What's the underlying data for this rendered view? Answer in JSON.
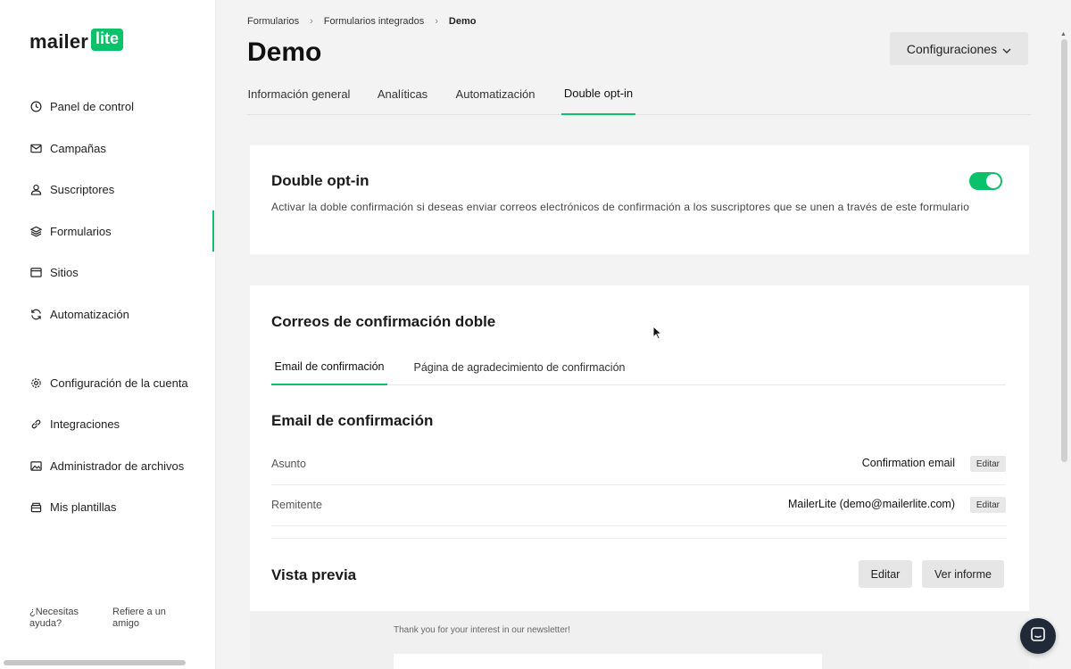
{
  "brand": {
    "logo_text": "mailer",
    "logo_badge": "lite",
    "accent": "#09c269"
  },
  "sidebar": {
    "items": [
      {
        "label": "Panel de control",
        "icon": "dashboard-icon"
      },
      {
        "label": "Campañas",
        "icon": "mail-icon"
      },
      {
        "label": "Suscriptores",
        "icon": "user-icon"
      },
      {
        "label": "Formularios",
        "icon": "layers-icon",
        "active": true
      },
      {
        "label": "Sitios",
        "icon": "browser-icon"
      },
      {
        "label": "Automatización",
        "icon": "refresh-icon"
      },
      {
        "label": "Configuración de la cuenta",
        "icon": "gear-icon"
      },
      {
        "label": "Integraciones",
        "icon": "link-icon"
      },
      {
        "label": "Administrador de archivos",
        "icon": "image-icon"
      },
      {
        "label": "Mis plantillas",
        "icon": "template-icon"
      }
    ],
    "help": {
      "line1": "¿Necesitas",
      "line2": "ayuda?"
    },
    "refer": {
      "line1": "Refiere a un",
      "line2": "amigo"
    }
  },
  "breadcrumb": [
    "Formularios",
    "Formularios integrados",
    "Demo"
  ],
  "page_title": "Demo",
  "config_button": "Configuraciones",
  "tabs": [
    {
      "label": "Información general"
    },
    {
      "label": "Analíticas"
    },
    {
      "label": "Automatización"
    },
    {
      "label": "Double opt-in",
      "active": true
    }
  ],
  "double_optin": {
    "title": "Double opt-in",
    "description": "Activar la doble confirmación si deseas enviar correos electrónicos de confirmación a los suscriptores que se unen a través de este formulario",
    "enabled": true
  },
  "confirm_emails": {
    "title": "Correos de confirmación doble",
    "subtabs": [
      {
        "label": "Email de confirmación",
        "active": true
      },
      {
        "label": "Página de agradecimiento de confirmación"
      }
    ],
    "email_title": "Email de confirmación",
    "rows": [
      {
        "label": "Asunto",
        "value": "Confirmation email",
        "edit": "Editar"
      },
      {
        "label": "Remitente",
        "value": "MailerLite (demo@mailerlite.com)",
        "edit": "Editar"
      }
    ],
    "preview_title": "Vista previa",
    "edit_button": "Editar",
    "report_button": "Ver informe",
    "preview_message": "Thank you for your interest in our newsletter!"
  }
}
